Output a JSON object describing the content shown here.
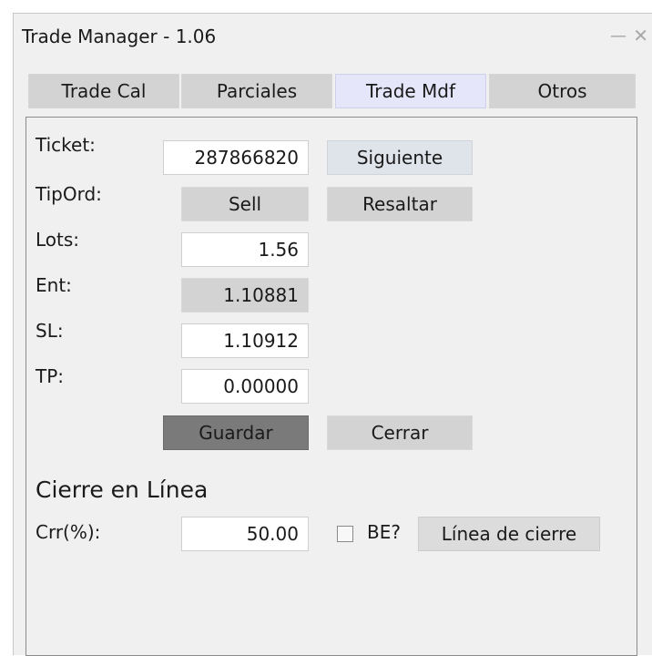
{
  "window": {
    "title": "Trade Manager - 1.06",
    "minimize_glyph": "—",
    "close_glyph": "✕"
  },
  "tabs": [
    {
      "label": "Trade Cal",
      "active": false
    },
    {
      "label": "Parciales",
      "active": false
    },
    {
      "label": "Trade Mdf",
      "active": true
    },
    {
      "label": "Otros",
      "active": false
    }
  ],
  "form": {
    "ticket_label": "Ticket:",
    "ticket_value": "287866820",
    "next_button": "Siguiente",
    "tipord_label": "TipOrd:",
    "tipord_value": "Sell",
    "highlight_button": "Resaltar",
    "lots_label": "Lots:",
    "lots_value": "1.56",
    "ent_label": "Ent:",
    "ent_value": "1.10881",
    "sl_label": "SL:",
    "sl_value": "1.10912",
    "tp_label": "TP:",
    "tp_value": "0.00000",
    "save_button": "Guardar",
    "close_button": "Cerrar"
  },
  "cierre": {
    "heading": "Cierre en Línea",
    "crr_label": "Crr(%):",
    "crr_value": "50.00",
    "be_label": "BE?",
    "be_checked": false,
    "line_button": "Línea de cierre"
  },
  "colors": {
    "active_tab": "#e6e6fa",
    "inactive_tab": "#d3d3d3",
    "save_button": "#7a7a7a"
  }
}
